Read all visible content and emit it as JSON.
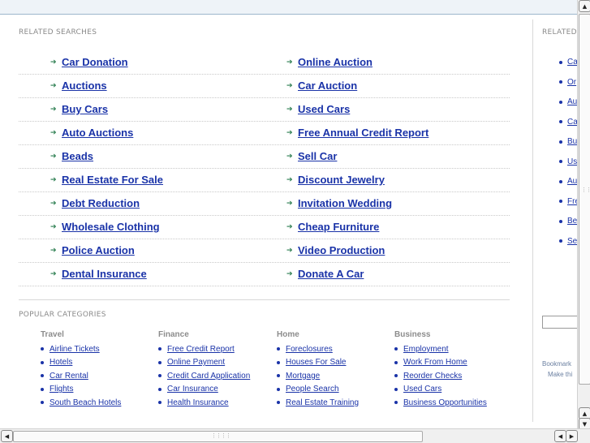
{
  "related": {
    "title": "RELATED SEARCHES",
    "left": [
      "Car Donation",
      "Auctions",
      "Buy Cars",
      "Auto Auctions",
      "Beads",
      "Real Estate For Sale",
      "Debt Reduction",
      "Wholesale Clothing",
      "Police Auction",
      "Dental Insurance"
    ],
    "right": [
      "Online Auction",
      "Car Auction",
      "Used Cars",
      "Free Annual Credit Report",
      "Sell Car",
      "Discount Jewelry",
      "Invitation Wedding",
      "Cheap Furniture",
      "Video Production",
      "Donate A Car"
    ]
  },
  "popular": {
    "title": "POPULAR CATEGORIES",
    "columns": [
      {
        "head": "Travel",
        "links": [
          "Airline Tickets",
          "Hotels",
          "Car Rental",
          "Flights",
          "South Beach Hotels"
        ]
      },
      {
        "head": "Finance",
        "links": [
          "Free Credit Report",
          "Online Payment",
          "Credit Card Application",
          "Car Insurance",
          "Health Insurance"
        ]
      },
      {
        "head": "Home",
        "links": [
          "Foreclosures",
          "Houses For Sale",
          "Mortgage",
          "People Search",
          "Real Estate Training"
        ]
      },
      {
        "head": "Business",
        "links": [
          "Employment",
          "Work From Home",
          "Reorder Checks",
          "Used Cars",
          "Business Opportunities"
        ]
      }
    ]
  },
  "side": {
    "title": "RELATED",
    "links": [
      "Ca",
      "Or",
      "Au",
      "Ca",
      "Bu",
      "Us",
      "Au",
      "Fre",
      "Be",
      "Se"
    ],
    "bookmark": "Bookmark",
    "make": "Make thi"
  }
}
